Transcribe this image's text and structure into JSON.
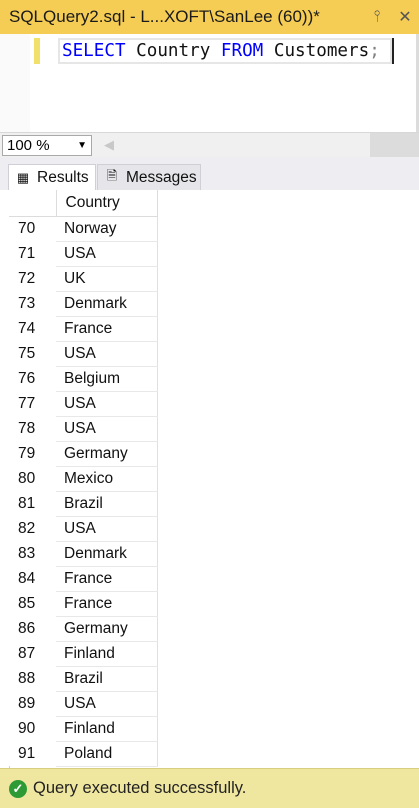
{
  "window": {
    "tab_title": "SQLQuery2.sql - L...XOFT\\SanLee (60))*",
    "pin_icon": "pin-icon",
    "close_icon": "close-icon"
  },
  "editor": {
    "keyword_select": "SELECT",
    "column": "Country",
    "keyword_from": "FROM",
    "table": "Customers",
    "terminator": ";"
  },
  "zoom": {
    "value": "100 %"
  },
  "result_tabs": {
    "results_label": "Results",
    "messages_label": "Messages"
  },
  "grid": {
    "column_header": "Country",
    "rows": [
      {
        "num": "70",
        "country": "Norway"
      },
      {
        "num": "71",
        "country": "USA"
      },
      {
        "num": "72",
        "country": "UK"
      },
      {
        "num": "73",
        "country": "Denmark"
      },
      {
        "num": "74",
        "country": "France"
      },
      {
        "num": "75",
        "country": "USA"
      },
      {
        "num": "76",
        "country": "Belgium"
      },
      {
        "num": "77",
        "country": "USA"
      },
      {
        "num": "78",
        "country": "USA"
      },
      {
        "num": "79",
        "country": "Germany"
      },
      {
        "num": "80",
        "country": "Mexico"
      },
      {
        "num": "81",
        "country": "Brazil"
      },
      {
        "num": "82",
        "country": "USA"
      },
      {
        "num": "83",
        "country": "Denmark"
      },
      {
        "num": "84",
        "country": "France"
      },
      {
        "num": "85",
        "country": "France"
      },
      {
        "num": "86",
        "country": "Germany"
      },
      {
        "num": "87",
        "country": "Finland"
      },
      {
        "num": "88",
        "country": "Brazil"
      },
      {
        "num": "89",
        "country": "USA"
      },
      {
        "num": "90",
        "country": "Finland"
      },
      {
        "num": "91",
        "country": "Poland"
      }
    ]
  },
  "status": {
    "text": "Query executed successfully."
  },
  "colors": {
    "titlebar": "#f5cc54",
    "keyword": "#0000ff",
    "statusbar": "#efe6a0",
    "success": "#2e9a35"
  }
}
